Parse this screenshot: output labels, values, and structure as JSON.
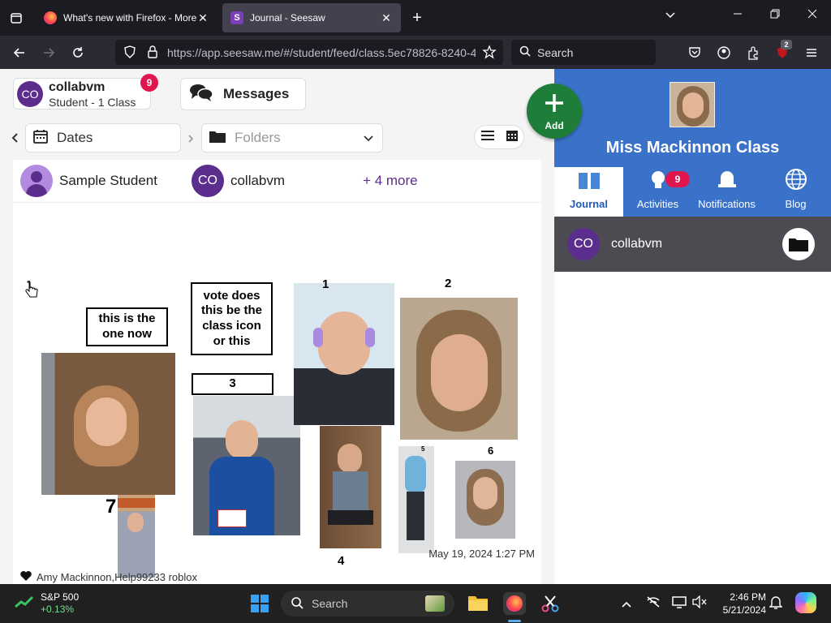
{
  "browser": {
    "tabs": [
      {
        "title": "What's new with Firefox - More",
        "active": false
      },
      {
        "title": "Journal - Seesaw",
        "active": true
      }
    ],
    "url": "https://app.seesaw.me/#/student/feed/class.5ec78826-8240-4",
    "search_placeholder": "Search",
    "extension_badge": "2"
  },
  "header": {
    "account_name": "collabvm",
    "account_sub": "Student - 1 Class",
    "avatar_initials": "CO",
    "account_badge": "9",
    "messages_label": "Messages",
    "add_label": "Add"
  },
  "filters": {
    "dates_label": "Dates",
    "folders_placeholder": "Folders"
  },
  "post": {
    "students": [
      {
        "name": "Sample Student"
      },
      {
        "name": "collabvm",
        "initials": "CO"
      }
    ],
    "more_label": "+ 4 more",
    "labels": {
      "box1": "this is the one now",
      "box2": "vote does this be the class icon or this",
      "box3": "3"
    },
    "numbers": [
      "1",
      "2",
      "4",
      "5",
      "6",
      "7"
    ],
    "date": "May 19, 2024 1:27 PM",
    "likes": "Amy Mackinnon,Help99233 roblox"
  },
  "class_panel": {
    "title": "Miss Mackinnon Class",
    "tabs": [
      {
        "label": "Journal",
        "active": true
      },
      {
        "label": "Activities",
        "badge": "9"
      },
      {
        "label": "Notifications"
      },
      {
        "label": "Blog"
      }
    ],
    "member": {
      "name": "collabvm",
      "initials": "CO"
    }
  },
  "taskbar": {
    "stock_name": "S&P 500",
    "stock_change": "+0.13%",
    "search_placeholder": "Search",
    "time": "2:46 PM",
    "date": "5/21/2024"
  },
  "colors": {
    "accent_green": "#1f7d3a",
    "class_blue": "#3a72c9",
    "badge_red": "#e0174e",
    "avatar_purple": "#5b2d8c"
  }
}
